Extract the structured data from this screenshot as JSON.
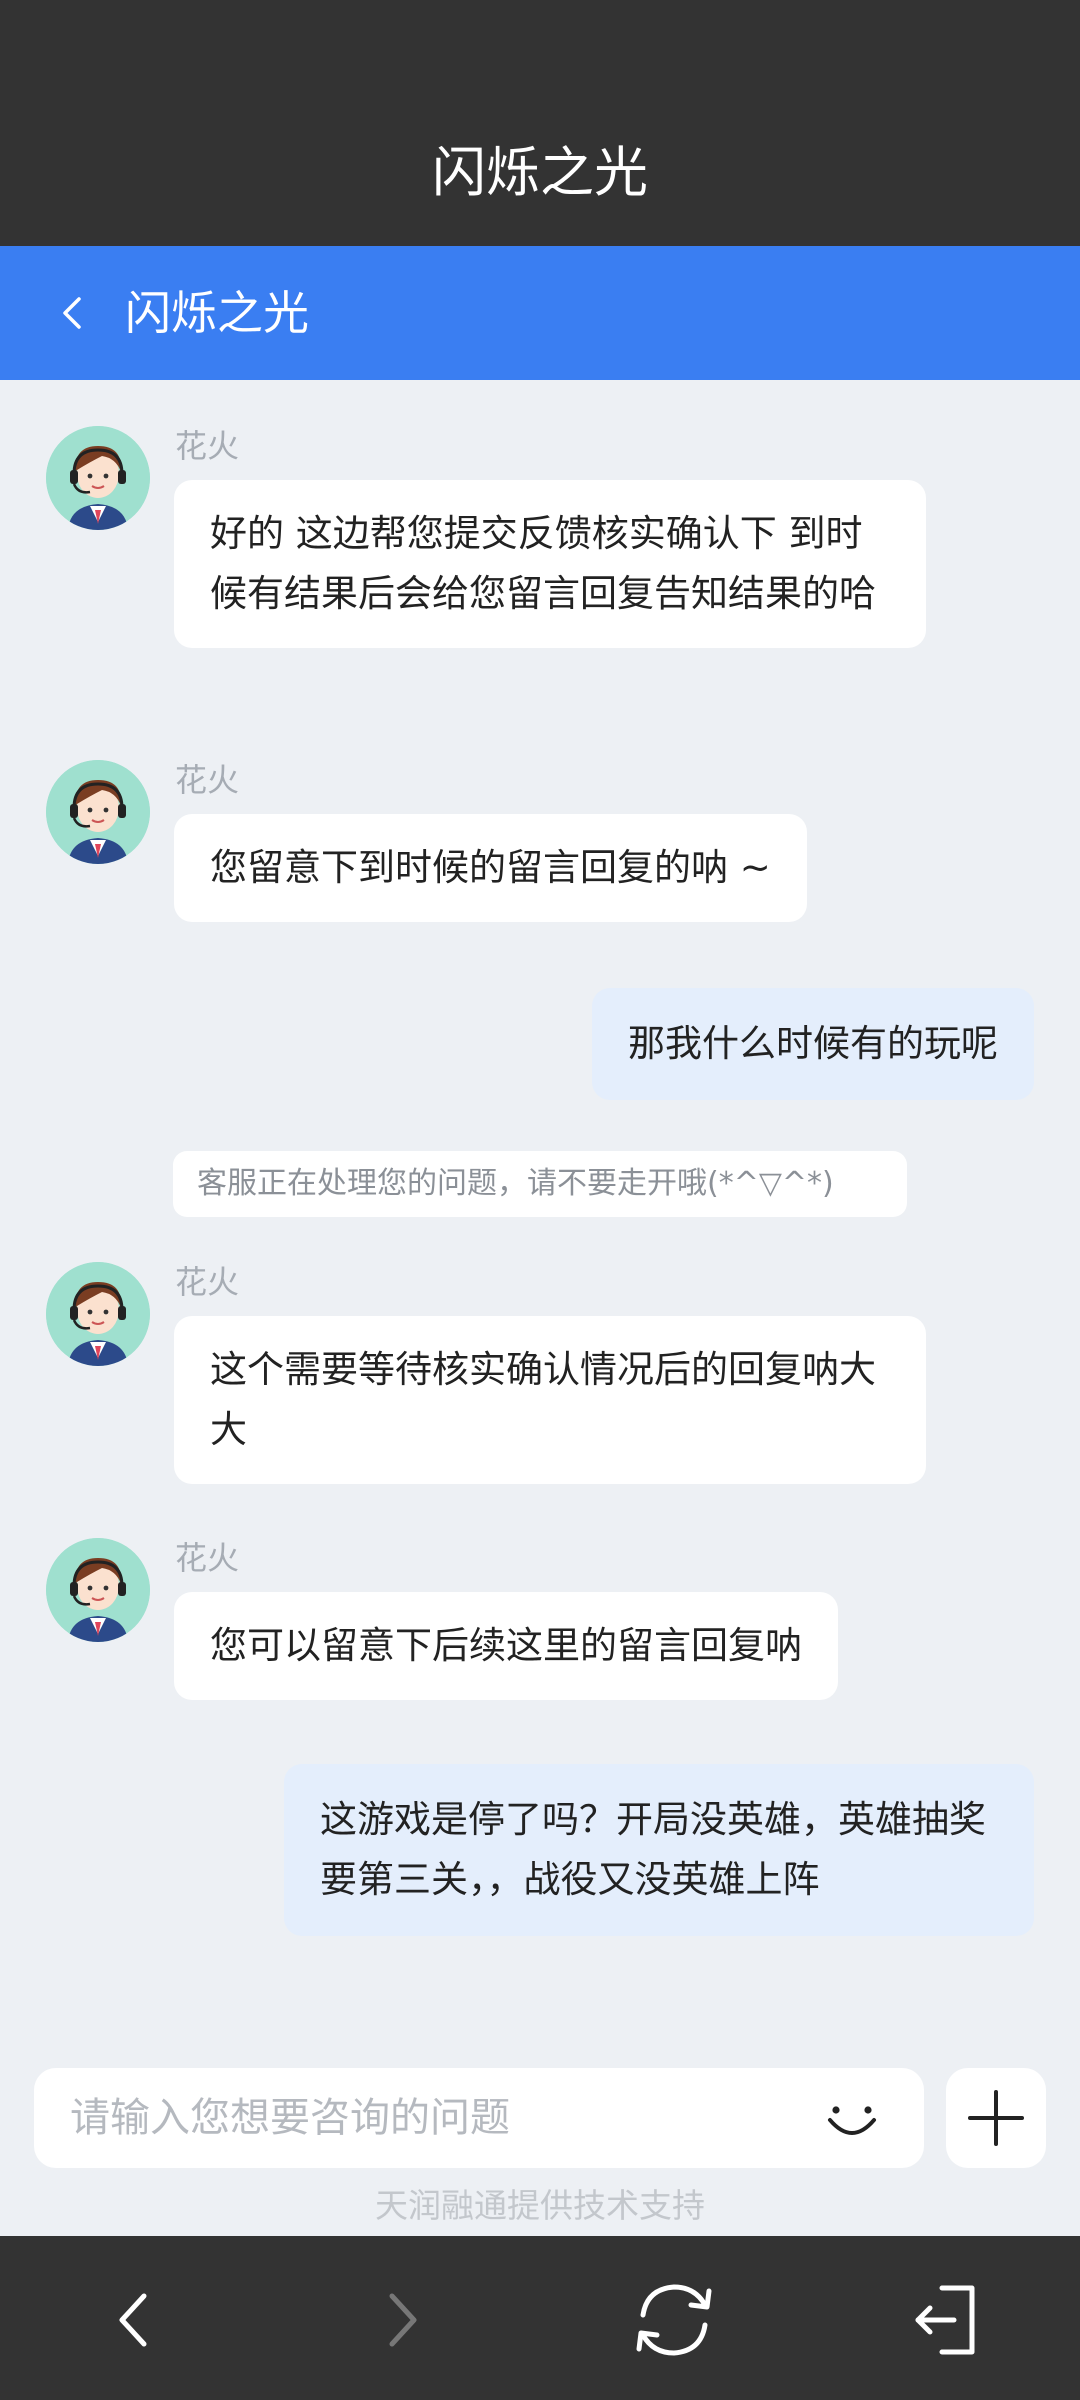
{
  "status_title": "闪烁之光",
  "nav": {
    "title": "闪烁之光"
  },
  "messages": [
    {
      "sender": "花火",
      "text": "好的 这边帮您提交反馈核实确认下 到时候有结果后会给您留言回复告知结果的哈"
    },
    {
      "sender": "花火",
      "text": "您留意下到时候的留言回复的呐 ~"
    },
    {
      "text": "那我什么时候有的玩呢"
    },
    {
      "text": "客服正在处理您的问题，请不要走开哦(*^▽^*)"
    },
    {
      "sender": "花火",
      "text": "这个需要等待核实确认情况后的回复呐大大"
    },
    {
      "sender": "花火",
      "text": "您可以留意下后续这里的留言回复呐"
    },
    {
      "text": "这游戏是停了吗？开局没英雄，英雄抽奖要第三关，，战役又没英雄上阵"
    }
  ],
  "input": {
    "placeholder": "请输入您想要咨询的问题"
  },
  "support_text": "天润融通提供技术支持",
  "colors": {
    "header": "#333333",
    "nav": "#3a7ef2",
    "background": "#edf0f4",
    "user_bubble": "#e4eefc",
    "agent_bubble": "#ffffff"
  },
  "icons": [
    "back-arrow-icon",
    "avatar-icon",
    "emoji-icon",
    "plus-icon",
    "browser-back-icon",
    "browser-forward-icon",
    "refresh-icon",
    "exit-icon"
  ]
}
